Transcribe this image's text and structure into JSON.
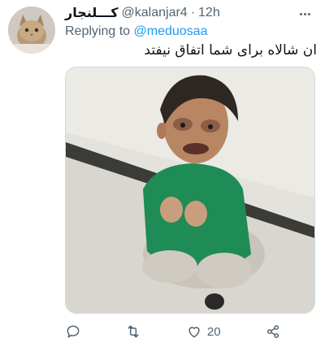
{
  "tweet": {
    "display_name": "کـــلنجار",
    "handle": "@kalanjar4",
    "separator": "·",
    "time": "12h",
    "replying_to_label": "Replying to",
    "replying_to_handle": "@meduosaa",
    "text": "ان شالاه برای شما اتفاق نیفتد",
    "icons": {
      "avatar": "cat-avatar",
      "more": "more-options-icon",
      "reply": "reply-icon",
      "retweet": "retweet-icon",
      "like": "like-icon",
      "share": "share-icon"
    },
    "actions": {
      "like_count": "20"
    }
  },
  "colors": {
    "link": "#1d9bf0",
    "secondary_text": "#536471",
    "border": "#cfd9de"
  }
}
